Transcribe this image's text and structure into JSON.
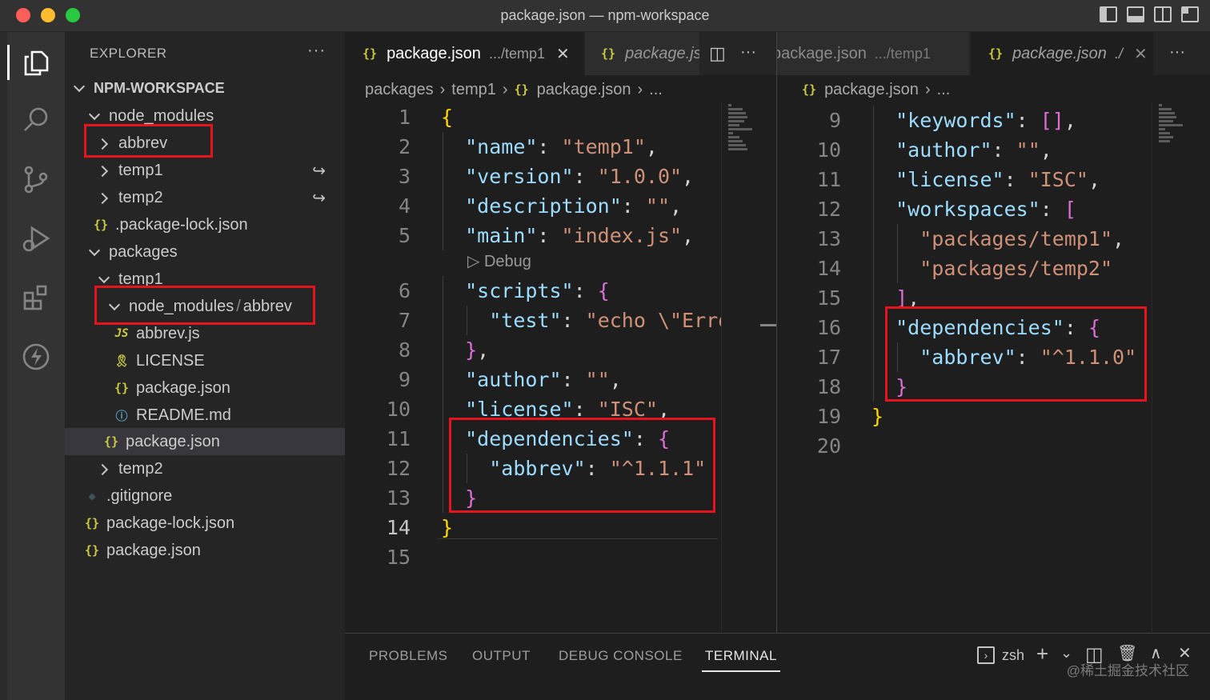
{
  "window": {
    "title": "package.json — npm-workspace"
  },
  "colors": {
    "highlight_box": "#e5141f",
    "json_icon": "#cbcb41",
    "key": "#9cdcfe",
    "string": "#ce9178",
    "brace_l1": "#ffd700",
    "brace_l2": "#da70d6"
  },
  "activity_bar": {
    "items": [
      "explorer-icon",
      "search-icon",
      "source-control-icon",
      "run-debug-icon",
      "extensions-icon",
      "lightning-icon"
    ]
  },
  "explorer": {
    "header": "EXPLORER",
    "more": "···",
    "root": "NPM-WORKSPACE",
    "items": [
      {
        "label": "node_modules",
        "kind": "folder-open"
      },
      {
        "label": "abbrev",
        "kind": "folder-closed"
      },
      {
        "label": "temp1",
        "kind": "folder-closed",
        "badge": "↪"
      },
      {
        "label": "temp2",
        "kind": "folder-closed",
        "badge": "↪"
      },
      {
        "label": ".package-lock.json",
        "kind": "json"
      },
      {
        "label": "packages",
        "kind": "folder-open"
      },
      {
        "label": "temp1",
        "kind": "folder-open"
      },
      {
        "label": "node_modules",
        "label2": "/",
        "label3": "abbrev",
        "kind": "folder-open"
      },
      {
        "label": "abbrev.js",
        "kind": "js"
      },
      {
        "label": "LICENSE",
        "kind": "license"
      },
      {
        "label": "package.json",
        "kind": "json"
      },
      {
        "label": "README.md",
        "kind": "info"
      },
      {
        "label": "package.json",
        "kind": "json",
        "selected": true
      },
      {
        "label": "temp2",
        "kind": "folder-closed"
      },
      {
        "label": ".gitignore",
        "kind": "git"
      },
      {
        "label": "package-lock.json",
        "kind": "json"
      },
      {
        "label": "package.json",
        "kind": "json"
      }
    ]
  },
  "icons": {
    "json_brace": "{}",
    "js": "JS",
    "license": "🎗",
    "info": "ⓘ",
    "git": "◆"
  },
  "editor_left": {
    "tabs": [
      {
        "name": "package.json",
        "desc": ".../temp1",
        "close": "✕"
      },
      {
        "name": "package.js"
      }
    ],
    "split": "◫",
    "more": "···",
    "breadcrumb": [
      "packages",
      "temp1",
      "package.json",
      "..."
    ],
    "codelens": "▷ Debug",
    "current_line": "14"
  },
  "editor_right": {
    "tabs": [
      {
        "name": "package.json",
        "desc": ".../temp1"
      },
      {
        "name": "package.json",
        "desc": "./",
        "close": "✕"
      }
    ],
    "more": "···",
    "breadcrumb": [
      "package.json",
      "..."
    ]
  },
  "panel": {
    "tabs": [
      "PROBLEMS",
      "OUTPUT",
      "DEBUG CONSOLE",
      "TERMINAL"
    ],
    "active_tab": "TERMINAL",
    "shell": "zsh",
    "actions": [
      "+",
      "⌄",
      "◫",
      "🗑",
      "∧",
      "✕"
    ]
  },
  "watermark": "@稀土掘金技术社区"
}
